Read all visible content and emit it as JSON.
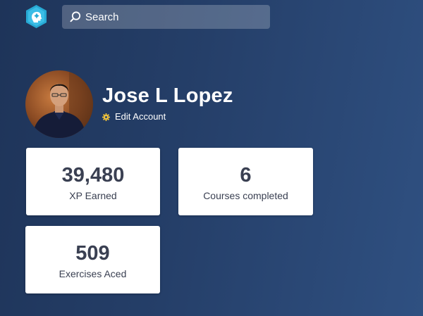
{
  "search": {
    "placeholder": "Search"
  },
  "profile": {
    "name": "Jose L Lopez",
    "edit_label": "Edit Account"
  },
  "stats": [
    {
      "value": "39,480",
      "label": "XP Earned"
    },
    {
      "value": "6",
      "label": "Courses completed"
    },
    {
      "value": "509",
      "label": "Exercises Aced"
    }
  ],
  "icons": {
    "logo": "hexagon-head-logo-icon",
    "search": "search-icon",
    "edit": "gear-icon"
  },
  "colors": {
    "background_start": "#1e3459",
    "background_end": "#2f5081",
    "logo": "#27a9d4",
    "gear": "#f0c23a",
    "card_text": "#3a4052"
  }
}
